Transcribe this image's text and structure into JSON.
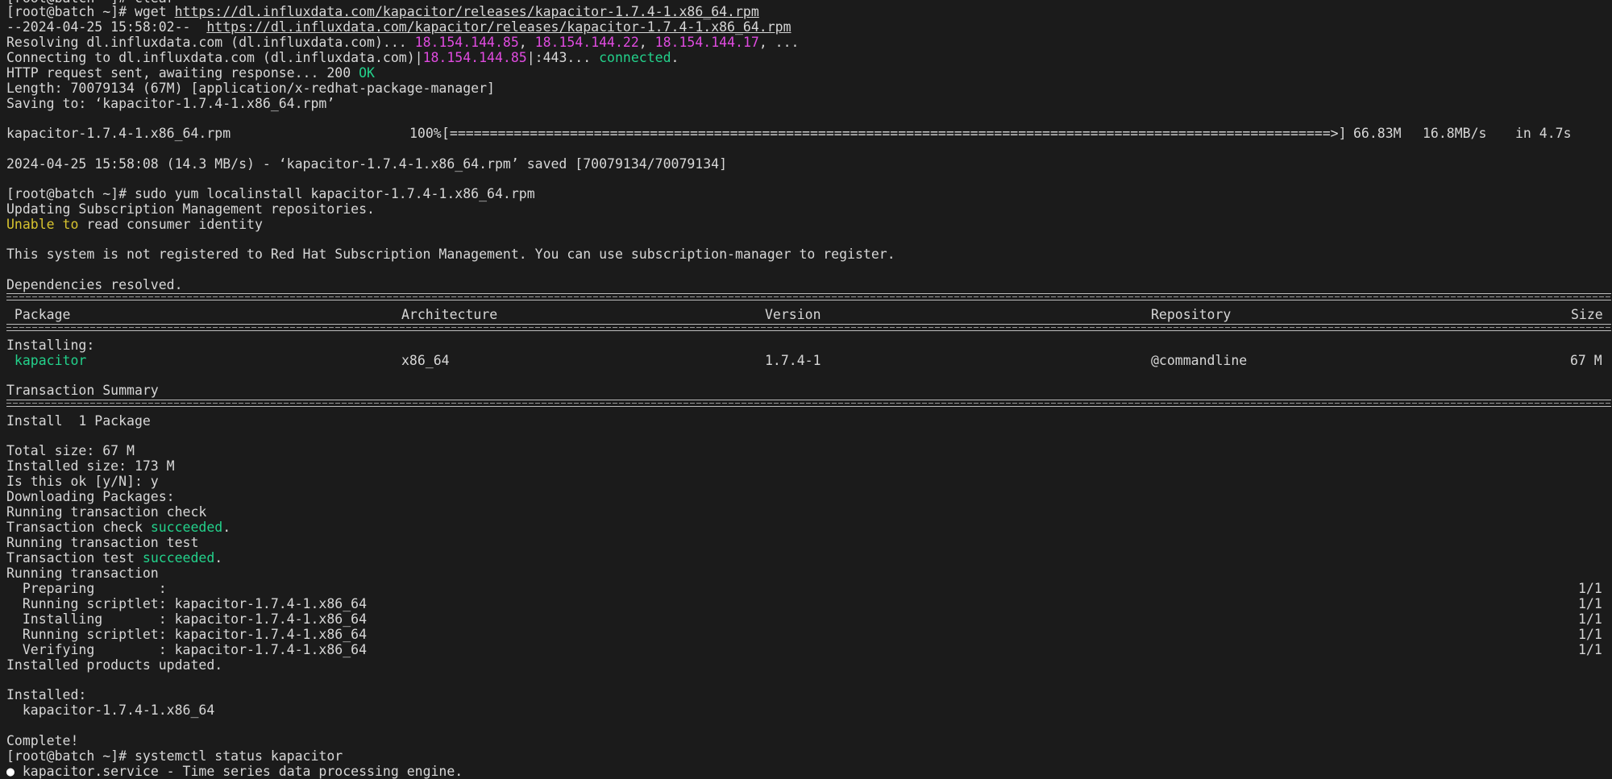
{
  "terminal": {
    "prompt1": "[root@batch ~]# wget ",
    "wget_url": "https://dl.influxdata.com/kapacitor/releases/kapacitor-1.7.4-1.x86_64.rpm",
    "ts_prefix": "--2024-04-25 15:58:02--  ",
    "resolving_prefix": "Resolving dl.influxdata.com (dl.influxdata.com)... ",
    "ip1": "18.154.144.85",
    "ip2": "18.154.144.22",
    "ip3": "18.154.144.17",
    "ellipsis": ", ...",
    "comma": ", ",
    "connecting_prefix": "Connecting to dl.influxdata.com (dl.influxdata.com)|",
    "connecting_ip": "18.154.144.85",
    "connecting_suffix": "|:443... ",
    "connected": "connected",
    "period": ".",
    "http_prefix": "HTTP request sent, awaiting response... 200 ",
    "http_ok": "OK",
    "length_line": "Length: 70079134 (67M) [application/x-redhat-package-manager]",
    "saving_line": "Saving to: ‘kapacitor-1.7.4-1.x86_64.rpm’",
    "progress_file": "kapacitor-1.7.4-1.x86_64.rpm",
    "progress_percent": "100%",
    "progress_size": "66.83M",
    "progress_speed": "16.8MB/s",
    "progress_time": "in 4.7s",
    "saved_line": "2024-04-25 15:58:08 (14.3 MB/s) - ‘kapacitor-1.7.4-1.x86_64.rpm’ saved [70079134/70079134]",
    "prompt2": "[root@batch ~]# sudo yum localinstall kapacitor-1.7.4-1.x86_64.rpm",
    "updating_line": "Updating Subscription Management repositories.",
    "unable_word": "Unable to",
    "unable_rest": " read consumer identity",
    "not_registered_line": "This system is not registered to Red Hat Subscription Management. You can use subscription-manager to register.",
    "deps_line": "Dependencies resolved.",
    "table_headers": {
      "package": " Package",
      "architecture": "Architecture",
      "version": "Version",
      "repository": "Repository",
      "size": "Size"
    },
    "installing_label": "Installing:",
    "pkg_name": " kapacitor",
    "pkg_arch": "x86_64",
    "pkg_version": "1.7.4-1",
    "pkg_repo": "@commandline",
    "pkg_size": "67 M",
    "transaction_summary": "Transaction Summary",
    "install_count": "Install  1 Package",
    "total_size": "Total size: 67 M",
    "installed_size": "Installed size: 173 M",
    "is_ok": "Is this ok [y/N]: y",
    "downloading": "Downloading Packages:",
    "running_check": "Running transaction check",
    "check_prefix": "Transaction check ",
    "succeeded": "succeeded",
    "running_test": "Running transaction test",
    "test_prefix": "Transaction test ",
    "running_tx": "Running transaction",
    "steps": [
      {
        "label": "  Preparing        :",
        "count": "1/1"
      },
      {
        "label": "  Running scriptlet: kapacitor-1.7.4-1.x86_64",
        "count": "1/1"
      },
      {
        "label": "  Installing       : kapacitor-1.7.4-1.x86_64",
        "count": "1/1"
      },
      {
        "label": "  Running scriptlet: kapacitor-1.7.4-1.x86_64",
        "count": "1/1"
      },
      {
        "label": "  Verifying        : kapacitor-1.7.4-1.x86_64",
        "count": "1/1"
      }
    ],
    "products_updated": "Installed products updated.",
    "installed_label": "Installed:",
    "installed_pkg": "  kapacitor-1.7.4-1.x86_64",
    "complete": "Complete!",
    "prompt3": "[root@batch ~]# systemctl status kapacitor",
    "bullet": "●",
    "service_line": " kapacitor.service - Time series data processing engine.",
    "progress_fraction": 1.0,
    "colors": {
      "background": "#1b1b1b",
      "text": "#d7d7d7",
      "ip": "#e04be0",
      "green": "#23d18b",
      "yellow": "#d7c32f"
    }
  }
}
